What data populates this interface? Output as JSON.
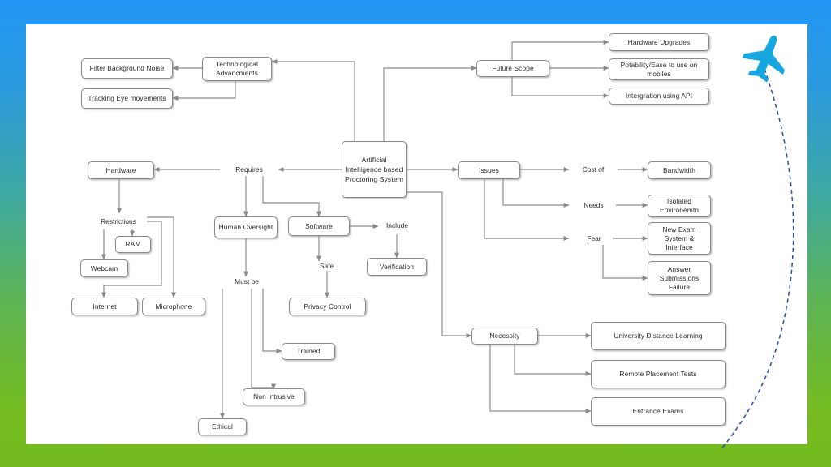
{
  "slide": {
    "background": {
      "gradient_top": "#2196f3",
      "gradient_bottom": "#76bc21"
    },
    "card_background": "#ffffff",
    "decoration": {
      "plane_icon": "airplane-icon",
      "plane_color": "#16a6e0",
      "trail_color": "#2f4f9e",
      "trail_style": "dashed"
    }
  },
  "diagram": {
    "type": "mind-map",
    "node_border_color": "#8a8a8a",
    "text_color": "#2b2b2b",
    "center": {
      "id": "center",
      "label": "Artificial Intelligence based Proctoring System"
    },
    "nodes": [
      {
        "id": "filter-background-noise",
        "label": "Filter Background Noise"
      },
      {
        "id": "tracking-eye-movements",
        "label": "Tracking Eye movements"
      },
      {
        "id": "technological-advancments",
        "label": "Technological Advancments"
      },
      {
        "id": "future-scope",
        "label": "Future Scope"
      },
      {
        "id": "hardware-upgrades",
        "label": "Hardware Upgrades"
      },
      {
        "id": "potability-ease-to-use-on-mobiles",
        "label": "Potability/Ease to use on mobiles"
      },
      {
        "id": "intergration-using-api",
        "label": "Intergration using API"
      },
      {
        "id": "hardware",
        "label": "Hardware"
      },
      {
        "id": "ram",
        "label": "RAM"
      },
      {
        "id": "webcam",
        "label": "Webcam"
      },
      {
        "id": "internet",
        "label": "Internet"
      },
      {
        "id": "microphone",
        "label": "Microphone"
      },
      {
        "id": "human-oversight",
        "label": "Human Oversight"
      },
      {
        "id": "software",
        "label": "Software"
      },
      {
        "id": "verification",
        "label": "Verification"
      },
      {
        "id": "privacy-control",
        "label": "Privacy Control"
      },
      {
        "id": "trained",
        "label": "Trained"
      },
      {
        "id": "non-intrusive",
        "label": "Non Intrusive"
      },
      {
        "id": "ethical",
        "label": "Ethical"
      },
      {
        "id": "issues",
        "label": "Issues"
      },
      {
        "id": "bandwidth",
        "label": "Bandwidth"
      },
      {
        "id": "isolated-environemtn",
        "label": "Isolated Environemtn"
      },
      {
        "id": "new-exam-system-interface",
        "label": "New Exam System & Interface"
      },
      {
        "id": "answer-submissions-failure",
        "label": "Answer Submissions Failure"
      },
      {
        "id": "necessity",
        "label": "Necessity"
      },
      {
        "id": "university-distance-learning",
        "label": "University Distance Learning"
      },
      {
        "id": "remote-placement-tests",
        "label": "Remote Placement Tests"
      },
      {
        "id": "entrance-exams",
        "label": "Entrance Exams"
      }
    ],
    "edge_labels": [
      {
        "id": "requires",
        "label": "Requires"
      },
      {
        "id": "restrictions",
        "label": "Restrictions"
      },
      {
        "id": "include",
        "label": "Include"
      },
      {
        "id": "safe",
        "label": "Safe"
      },
      {
        "id": "must-be",
        "label": "Must be"
      },
      {
        "id": "cost-of",
        "label": "Cost of"
      },
      {
        "id": "needs",
        "label": "Needs"
      },
      {
        "id": "fear",
        "label": "Fear"
      }
    ]
  }
}
